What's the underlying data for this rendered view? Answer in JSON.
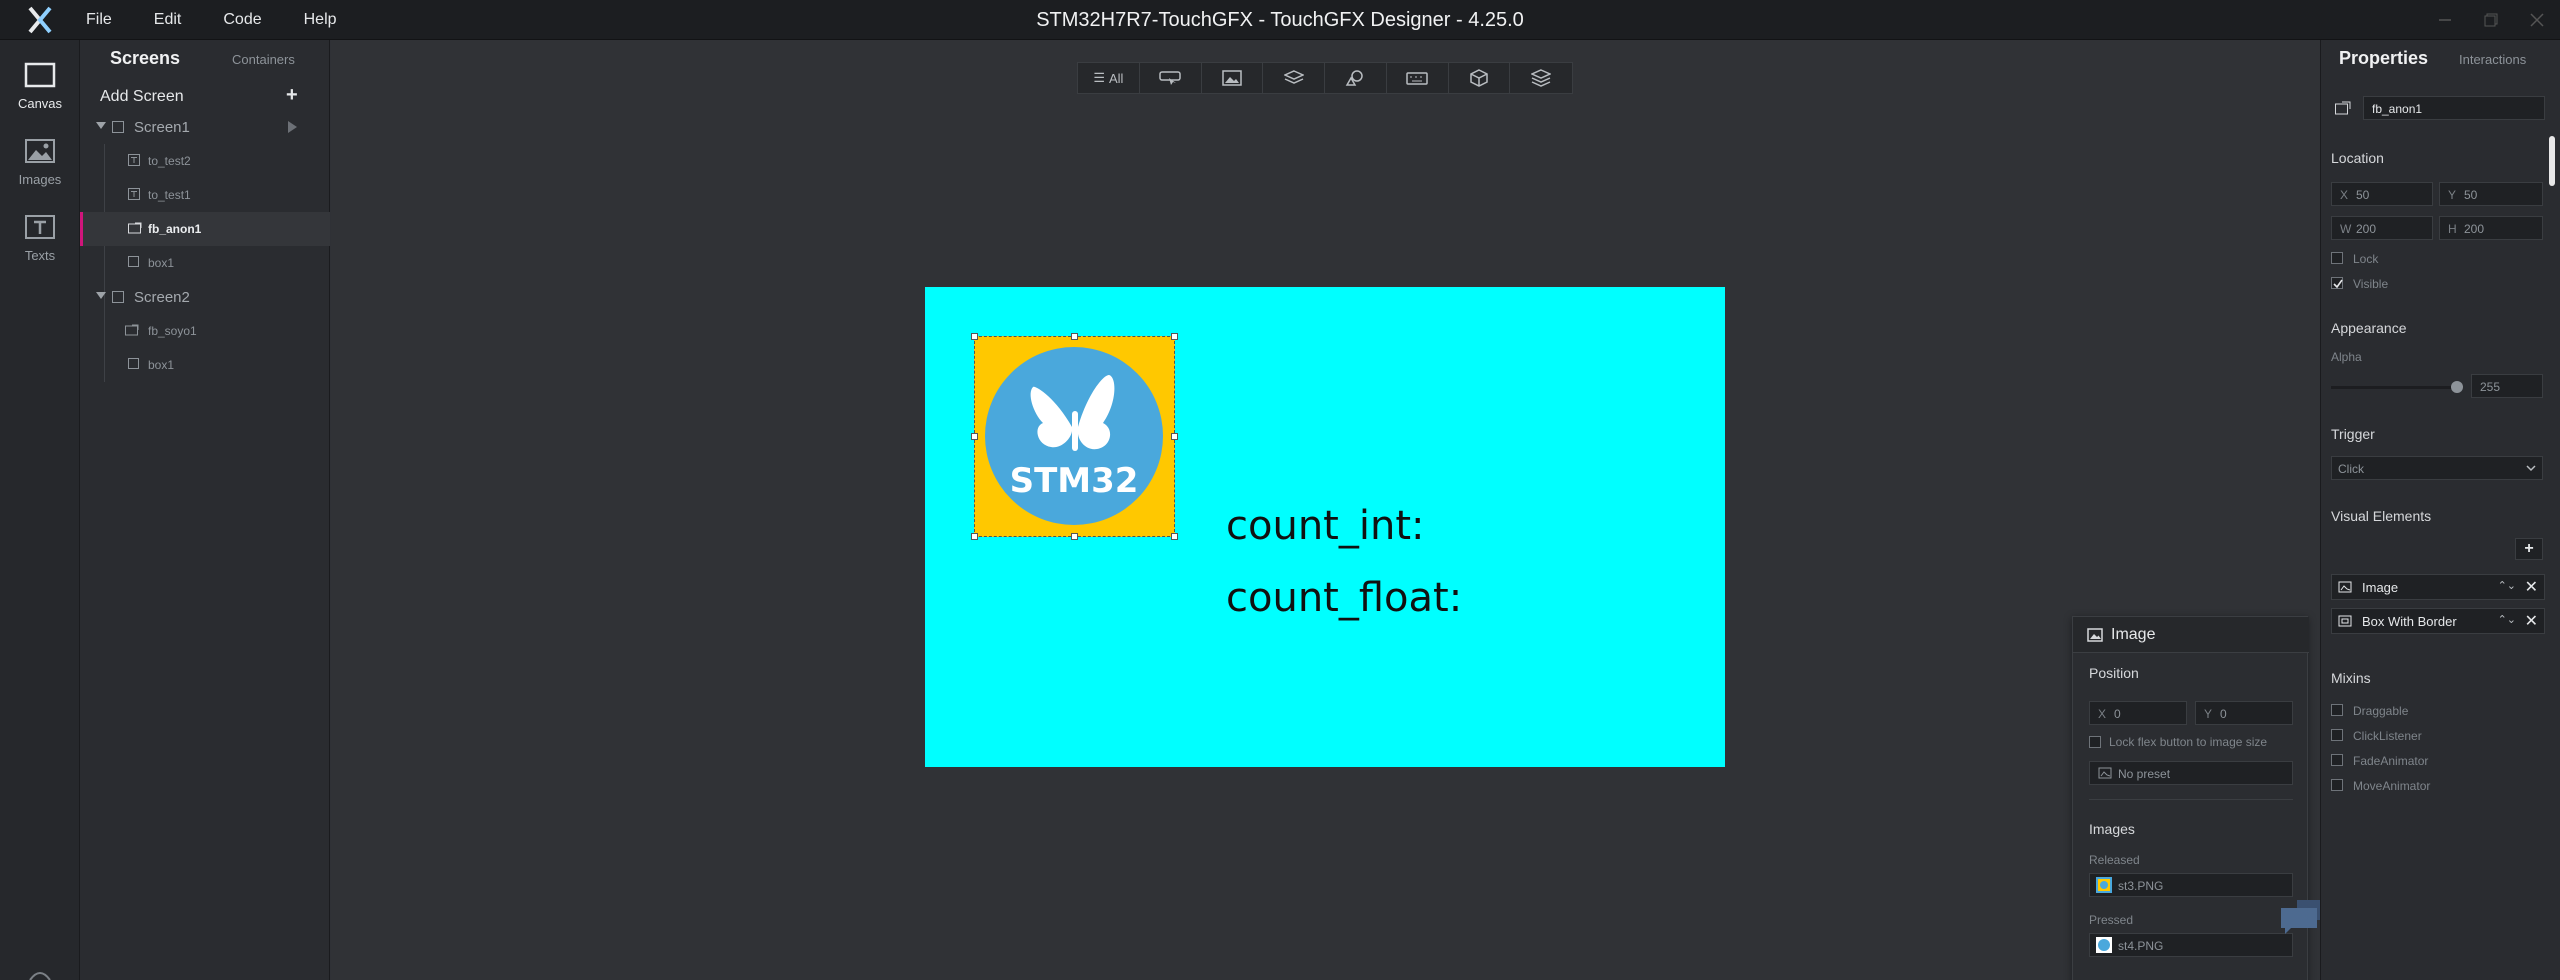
{
  "window": {
    "title": "STM32H7R7-TouchGFX - TouchGFX Designer - 4.25.0",
    "menu": [
      "File",
      "Edit",
      "Code",
      "Help"
    ]
  },
  "iconbar": {
    "items": [
      {
        "label": "Canvas",
        "icon": "canvas-icon"
      },
      {
        "label": "Images",
        "icon": "images-icon"
      },
      {
        "label": "Texts",
        "icon": "texts-icon"
      }
    ]
  },
  "screens_panel": {
    "tab_screens": "Screens",
    "tab_containers": "Containers",
    "add_screen": "Add Screen",
    "screen1": {
      "name": "Screen1",
      "widgets": [
        "to_test2",
        "to_test1",
        "fb_anon1",
        "box1"
      ]
    },
    "screen2": {
      "name": "Screen2",
      "widgets": [
        "fb_soyo1",
        "box1"
      ]
    }
  },
  "toolbar": {
    "all_label": "All"
  },
  "canvas": {
    "background": "#00ffff",
    "texts": [
      "count_int:",
      "count_float:"
    ],
    "logo_text": "STM32"
  },
  "image_panel": {
    "title": "Image",
    "position_label": "Position",
    "x": "0",
    "y": "0",
    "lock_label": "Lock flex button to image size",
    "preset": "No preset",
    "images_label": "Images",
    "released_label": "Released",
    "released_file": "st3.PNG",
    "pressed_label": "Pressed",
    "pressed_file": "st4.PNG"
  },
  "properties": {
    "title": "Properties",
    "tab_interactions": "Interactions",
    "name": "fb_anon1",
    "location_label": "Location",
    "x": "50",
    "y": "50",
    "w": "200",
    "h": "200",
    "lock_label": "Lock",
    "visible_label": "Visible",
    "appearance_label": "Appearance",
    "alpha_label": "Alpha",
    "alpha_value": "255",
    "trigger_label": "Trigger",
    "trigger_value": "Click",
    "visual_elements_label": "Visual Elements",
    "visual_elements": [
      "Image",
      "Box With Border"
    ],
    "mixins_label": "Mixins",
    "mixins": [
      "Draggable",
      "ClickListener",
      "FadeAnimator",
      "MoveAnimator"
    ]
  }
}
